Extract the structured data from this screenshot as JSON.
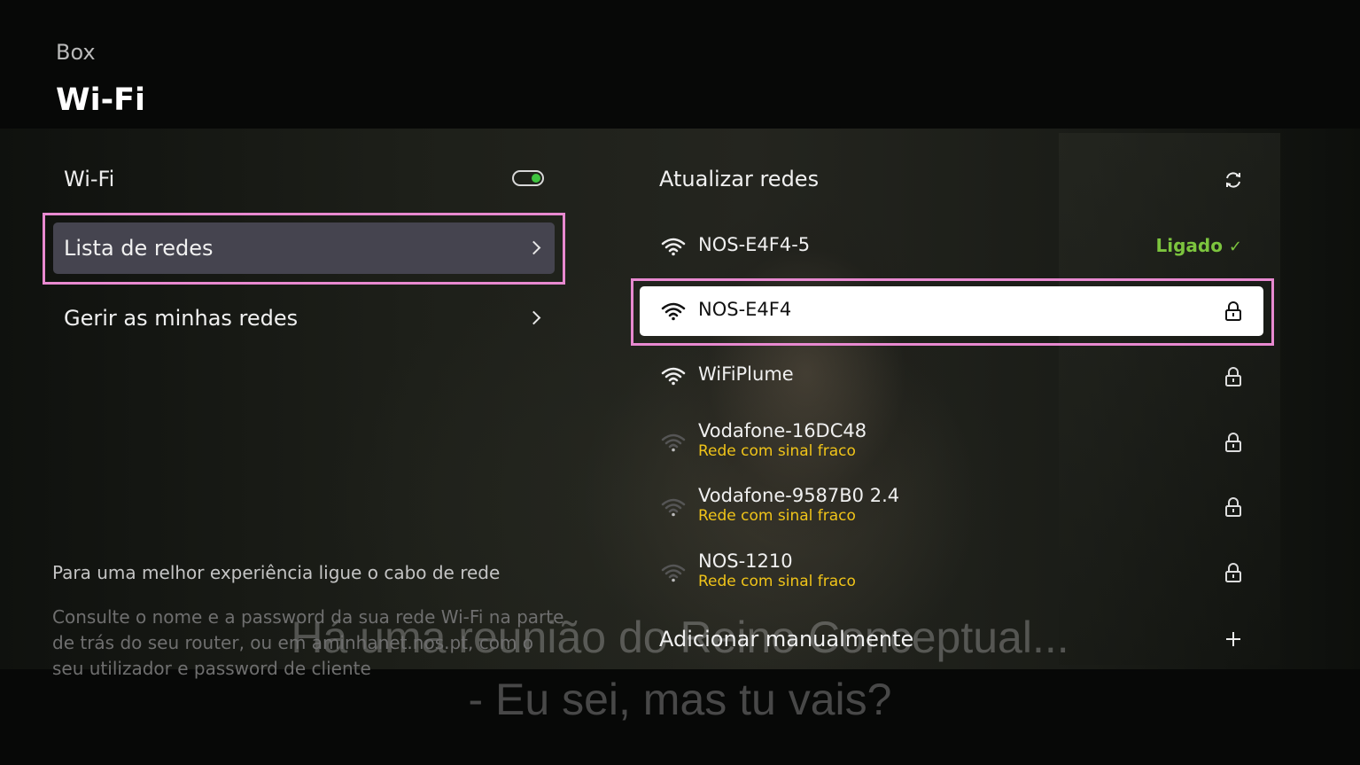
{
  "header": {
    "breadcrumb": "Box",
    "title": "Wi-Fi"
  },
  "left_menu": {
    "wifi_toggle": {
      "label": "Wi-Fi",
      "state": "on",
      "on_color": "#3fc43f"
    },
    "items": [
      {
        "label": "Lista de redes",
        "selected": true
      },
      {
        "label": "Gerir as minhas redes",
        "selected": false
      }
    ],
    "hint_title": "Para uma melhor experiência ligue o cabo de rede",
    "hint_body": "Consulte o nome e a password da sua rede Wi-Fi na parte de trás do seu router, ou em aminhanet.nos.pt, com o seu utilizador e password de cliente"
  },
  "networks_panel": {
    "refresh_label": "Atualizar redes",
    "connected_status": "Ligado",
    "weak_signal_text": "Rede com sinal fraco",
    "networks": [
      {
        "ssid": "NOS-E4F4-5",
        "connected": true,
        "locked": false,
        "weak": false,
        "signal": "strong"
      },
      {
        "ssid": "NOS-E4F4",
        "connected": false,
        "locked": true,
        "weak": false,
        "signal": "strong",
        "focused": true
      },
      {
        "ssid": "WiFiPlume",
        "connected": false,
        "locked": true,
        "weak": false,
        "signal": "strong"
      },
      {
        "ssid": "Vodafone-16DC48",
        "connected": false,
        "locked": true,
        "weak": true,
        "signal": "weak"
      },
      {
        "ssid": "Vodafone-9587B0 2.4",
        "connected": false,
        "locked": true,
        "weak": true,
        "signal": "weak"
      },
      {
        "ssid": "NOS-1210",
        "connected": false,
        "locked": true,
        "weak": true,
        "signal": "weak"
      }
    ],
    "add_manual_label": "Adicionar manualmente"
  },
  "video_subtitles": {
    "line1": "Há uma reunião do Reino Conceptual...",
    "line2": "- Eu sei, mas tu vais?"
  },
  "colors": {
    "highlight_border": "#e889d0",
    "connected_green": "#7cc43e",
    "weak_yellow": "#f0c419",
    "selected_row_bg": "#45444f"
  }
}
